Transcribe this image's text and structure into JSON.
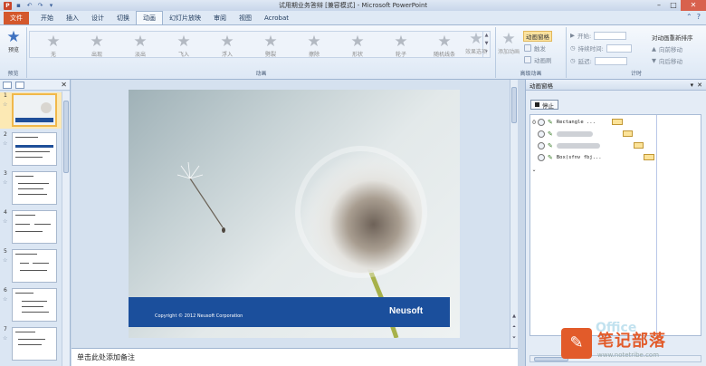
{
  "window": {
    "title": "试用期业务答辩 [兼容模式] - Microsoft PowerPoint",
    "app_letter": "P"
  },
  "tabs": [
    "文件",
    "开始",
    "插入",
    "设计",
    "切换",
    "动画",
    "幻灯片放映",
    "审阅",
    "视图",
    "Acrobat"
  ],
  "ribbon": {
    "preview_label": "预览",
    "preview_group": "预览",
    "animation_group": "动画",
    "animations": [
      "无",
      "出现",
      "淡出",
      "飞入",
      "浮入",
      "劈裂",
      "擦除",
      "形状",
      "轮子",
      "随机线条"
    ],
    "effect_options": "效果选项",
    "add_animation": "添加动画",
    "advanced_group": "高级动画",
    "anim_pane_btn": "动画窗格",
    "trigger": "触发",
    "anim_painter": "动画刷",
    "timing_group": "计时",
    "start_label": "开始:",
    "duration_label": "持续时间:",
    "delay_label": "延迟:",
    "reorder_title": "对动画重新排序",
    "move_earlier": "向前移动",
    "move_later": "向后移动"
  },
  "slides": {
    "numbers": [
      "1",
      "2",
      "3",
      "4",
      "5",
      "6",
      "7"
    ]
  },
  "slide": {
    "copyright": "Copyright © 2012 Neusoft Corporation",
    "brand": "Neusoft"
  },
  "notes": {
    "placeholder": "单击此处添加备注"
  },
  "anim_pane": {
    "title": "动画窗格",
    "stop": "停止",
    "rows": [
      {
        "num": "0",
        "name": "Rectangle ..."
      },
      {
        "num": "",
        "name": ""
      },
      {
        "num": "",
        "name": ""
      },
      {
        "num": "",
        "name": "Box(sfnv fbj..."
      }
    ]
  },
  "watermark": {
    "text": "笔记部落",
    "url": "www.notetribe.com"
  },
  "colors": {
    "file_tab": "#d4582c",
    "slide_band": "#1b4f9c",
    "timeline_bar": "#fce399"
  }
}
